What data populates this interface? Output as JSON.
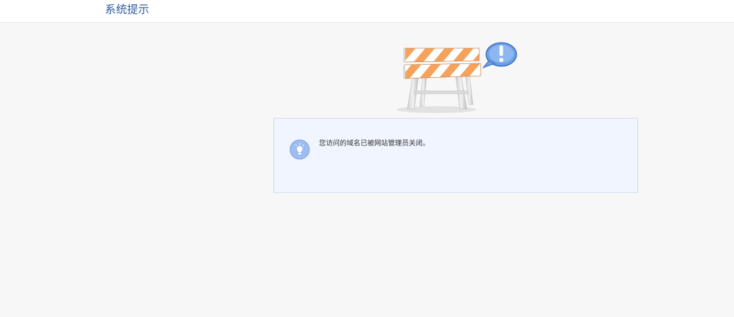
{
  "header": {
    "title": "系统提示"
  },
  "notice": {
    "message": "您访问的域名已被网站管理员关闭。",
    "illustration_icon": "road-barrier-icon",
    "alert_icon": "exclamation-bubble-icon",
    "message_icon": "lightbulb-icon"
  },
  "colors": {
    "title": "#2f5c9e",
    "stripe_orange": "#f5a25c",
    "alert_blue": "#6b9fe6",
    "box_bg": "#f0f5ff",
    "box_border": "#cfdcf2"
  }
}
